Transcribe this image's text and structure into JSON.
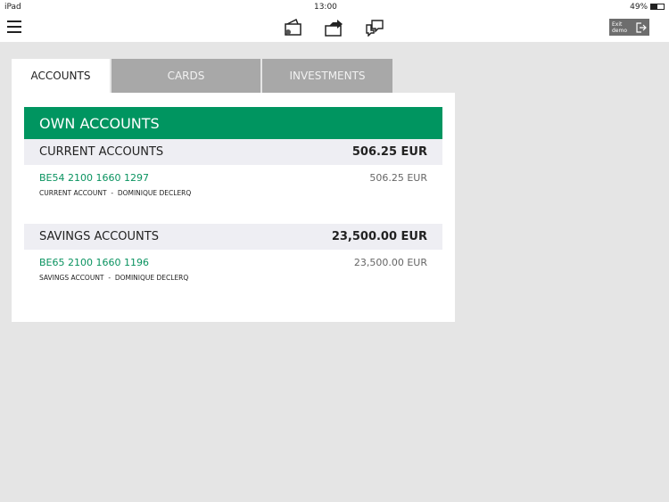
{
  "status": {
    "device": "iPad",
    "time": "13:00",
    "battery": "49%"
  },
  "topbar": {
    "exit_line1": "Exit",
    "exit_line2": "demo"
  },
  "tabs": [
    {
      "label": "ACCOUNTS"
    },
    {
      "label": "CARDS"
    },
    {
      "label": "INVESTMENTS"
    }
  ],
  "section": {
    "title": "OWN ACCOUNTS"
  },
  "groups": [
    {
      "title": "CURRENT ACCOUNTS",
      "total": "506.25 EUR",
      "accounts": [
        {
          "iban": "BE54 2100 1660 1297",
          "amount": "506.25 EUR",
          "type": "CURRENT ACCOUNT",
          "sep": "-",
          "holder": "DOMINIQUE DECLERQ"
        }
      ]
    },
    {
      "title": "SAVINGS ACCOUNTS",
      "total": "23,500.00 EUR",
      "accounts": [
        {
          "iban": "BE65 2100 1660 1196",
          "amount": "23,500.00 EUR",
          "type": "SAVINGS ACCOUNT",
          "sep": "-",
          "holder": "DOMINIQUE DECLERQ"
        }
      ]
    }
  ],
  "colors": {
    "brand": "#009560"
  }
}
